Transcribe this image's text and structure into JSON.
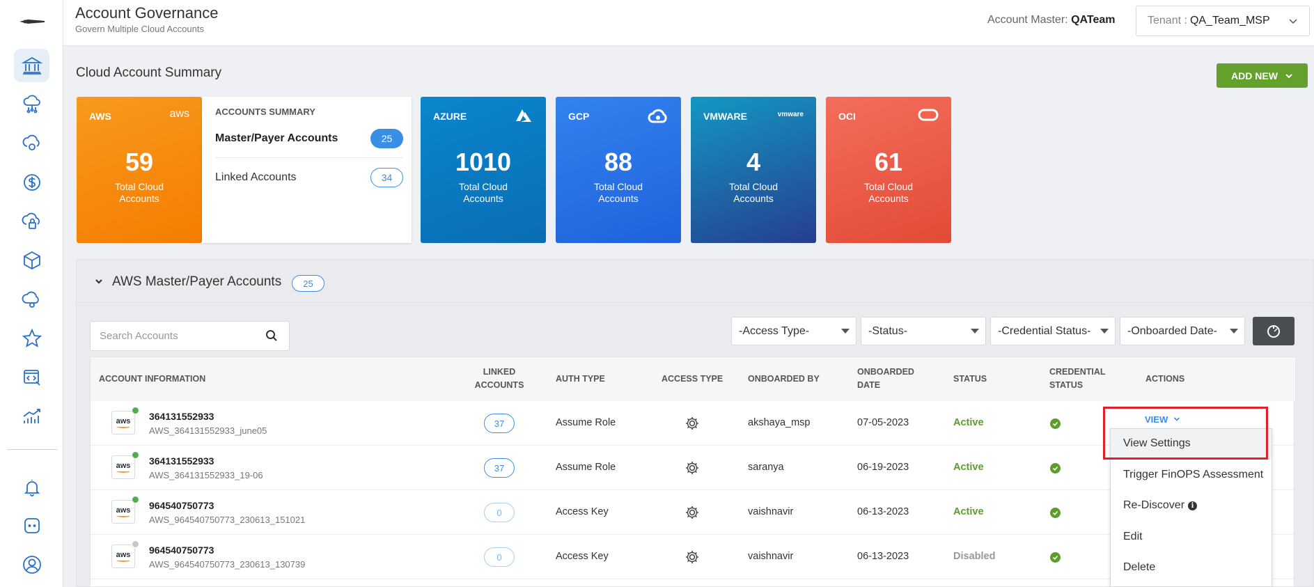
{
  "header": {
    "title": "Account Governance",
    "subtitle": "Govern Multiple Cloud Accounts",
    "account_master_label": "Account Master:",
    "account_master_value": "QATeam",
    "tenant_label": "Tenant :",
    "tenant_value": "QA_Team_MSP"
  },
  "summary": {
    "title": "Cloud Account Summary",
    "add_new_label": "ADD NEW",
    "cards": [
      {
        "name": "AWS",
        "icon_text": "aws",
        "count": "59",
        "label": "Total Cloud Accounts",
        "color": "#f68b13"
      },
      {
        "name": "AZURE",
        "icon_text": "",
        "count": "1010",
        "label": "Total Cloud Accounts",
        "color": "#0a7bc2"
      },
      {
        "name": "GCP",
        "icon_text": "",
        "count": "88",
        "label": "Total Cloud Accounts",
        "color": "#2a72e8"
      },
      {
        "name": "VMWARE",
        "icon_text": "vmware",
        "count": "4",
        "label": "Total Cloud Accounts",
        "color": "#1a6fac"
      },
      {
        "name": "OCI",
        "icon_text": "",
        "count": "61",
        "label": "Total Cloud Accounts",
        "color": "#ec5b46"
      }
    ],
    "accounts_summary": {
      "title": "ACCOUNTS SUMMARY",
      "master_label": "Master/Payer Accounts",
      "master_count": "25",
      "linked_label": "Linked Accounts",
      "linked_count": "34"
    }
  },
  "master_panel": {
    "title": "AWS Master/Payer Accounts",
    "count": "25",
    "search_placeholder": "Search Accounts",
    "filters": [
      "-Access Type-",
      "-Status-",
      "-Credential Status-",
      "-Onboarded Date-"
    ],
    "columns": {
      "account_info": "ACCOUNT INFORMATION",
      "linked_1": "LINKED",
      "linked_2": "ACCOUNTS",
      "auth_type": "AUTH TYPE",
      "access_type": "ACCESS TYPE",
      "onboarded_by": "ONBOARDED BY",
      "onboarded_date_1": "ONBOARDED",
      "onboarded_date_2": "DATE",
      "status": "STATUS",
      "credential_1": "CREDENTIAL",
      "credential_2": "STATUS",
      "actions": "ACTIONS"
    },
    "rows": [
      {
        "id": "364131552933",
        "name": "AWS_364131552933_june05",
        "linked": "37",
        "auth": "Assume Role",
        "by": "akshaya_msp",
        "date": "07-05-2023",
        "status": "Active",
        "online": true
      },
      {
        "id": "364131552933",
        "name": "AWS_364131552933_19-06",
        "linked": "37",
        "auth": "Assume Role",
        "by": "saranya",
        "date": "06-19-2023",
        "status": "Active",
        "online": true
      },
      {
        "id": "964540750773",
        "name": "AWS_964540750773_230613_151021",
        "linked": "0",
        "auth": "Access Key",
        "by": "vaishnavir",
        "date": "06-13-2023",
        "status": "Active",
        "online": true
      },
      {
        "id": "964540750773",
        "name": "AWS_964540750773_230613_130739",
        "linked": "0",
        "auth": "Access Key",
        "by": "vaishnavir",
        "date": "06-13-2023",
        "status": "Disabled",
        "online": false
      }
    ],
    "logo_text": "aws",
    "view_label": "VIEW",
    "menu": [
      "View Settings",
      "Trigger FinOPS Assessment",
      "Re-Discover",
      "Edit",
      "Delete"
    ]
  },
  "colors": {
    "accent": "#3a8ee6",
    "add_new": "#63a02c",
    "active": "#5a9e2b",
    "highlight": "#e0202a"
  }
}
